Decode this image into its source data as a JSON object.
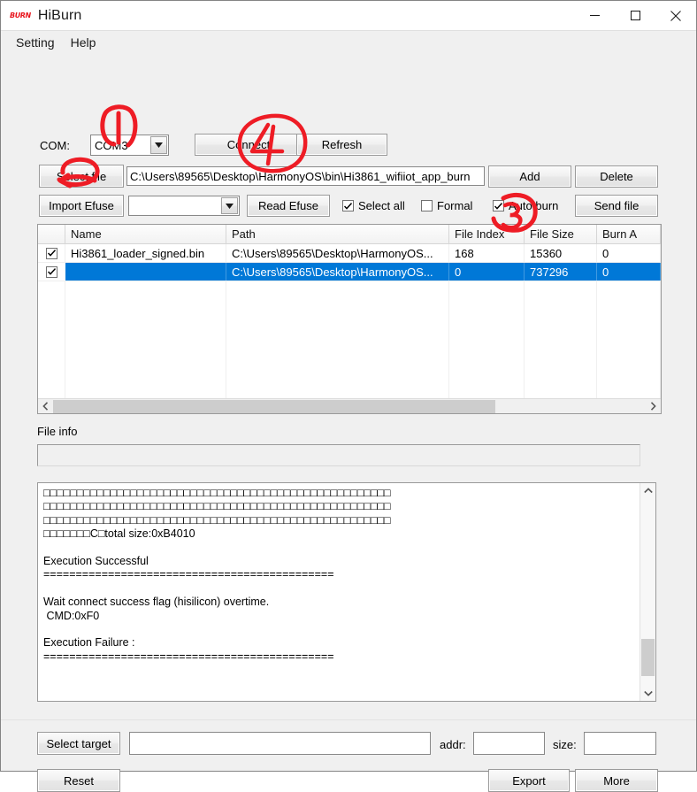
{
  "window": {
    "title": "HiBurn",
    "icon_text": "BURN",
    "minimize": "minimize",
    "maximize": "maximize",
    "close": "close"
  },
  "menu": {
    "items": [
      {
        "label": "Setting"
      },
      {
        "label": "Help"
      }
    ]
  },
  "toolbar": {
    "com_label": "COM:",
    "com_value": "COM3",
    "connect_label": "Connect",
    "refresh_label": "Refresh",
    "select_file_label": "Select file",
    "file_path_value": "C:\\Users\\89565\\Desktop\\HarmonyOS\\bin\\Hi3861_wifiiot_app_burn",
    "add_label": "Add",
    "delete_label": "Delete",
    "import_efuse_label": "Import Efuse",
    "efuse_combo_value": "",
    "read_efuse_label": "Read Efuse",
    "select_all_label": "Select all",
    "select_all_checked": true,
    "formal_label": "Formal",
    "formal_checked": false,
    "auto_burn_label": "Auto burn",
    "auto_burn_checked": true,
    "send_file_label": "Send file"
  },
  "file_list": {
    "columns": [
      {
        "key": "check",
        "label": ""
      },
      {
        "key": "name",
        "label": "Name"
      },
      {
        "key": "path",
        "label": "Path"
      },
      {
        "key": "index",
        "label": "File Index"
      },
      {
        "key": "size",
        "label": "File Size"
      },
      {
        "key": "burn",
        "label": "Burn A"
      }
    ],
    "rows": [
      {
        "checked": true,
        "name": "Hi3861_loader_signed.bin",
        "path": "C:\\Users\\89565\\Desktop\\HarmonyOS...",
        "index": "168",
        "size": "15360",
        "burn": "0",
        "selected": false
      },
      {
        "checked": true,
        "name": "",
        "path": "C:\\Users\\89565\\Desktop\\HarmonyOS...",
        "index": "0",
        "size": "737296",
        "burn": "0",
        "selected": true
      }
    ]
  },
  "file_info": {
    "label": "File info",
    "value": ""
  },
  "log": {
    "text": "□□□□□□□□□□□□□□□□□□□□□□□□□□□□□□□□□□□□□□□□□□□□□□□□□□□□\n□□□□□□□□□□□□□□□□□□□□□□□□□□□□□□□□□□□□□□□□□□□□□□□□□□□□\n□□□□□□□□□□□□□□□□□□□□□□□□□□□□□□□□□□□□□□□□□□□□□□□□□□□□\n□□□□□□□C□total size:0xB4010\n\nExecution Successful\n=============================================\n\nWait connect success flag (hisilicon) overtime.\n CMD:0xF0\n\nExecution Failure :\n============================================="
  },
  "bottom": {
    "select_target_label": "Select target",
    "target_value": "",
    "addr_label": "addr:",
    "addr_value": "",
    "size_label": "size:",
    "size_value": "",
    "reset_label": "Reset",
    "export_label": "Export",
    "more_label": "More"
  },
  "annotations": {
    "color": "#ee1c25",
    "marks": [
      {
        "id": "1",
        "target": "com-port-combo"
      },
      {
        "id": "2",
        "target": "select-file-button"
      },
      {
        "id": "3",
        "target": "auto-burn-checkbox"
      },
      {
        "id": "4",
        "target": "connect-button"
      }
    ]
  },
  "colors": {
    "selection": "#0078d7",
    "panel": "#f0f0f0",
    "annotation": "#ee1c25"
  }
}
